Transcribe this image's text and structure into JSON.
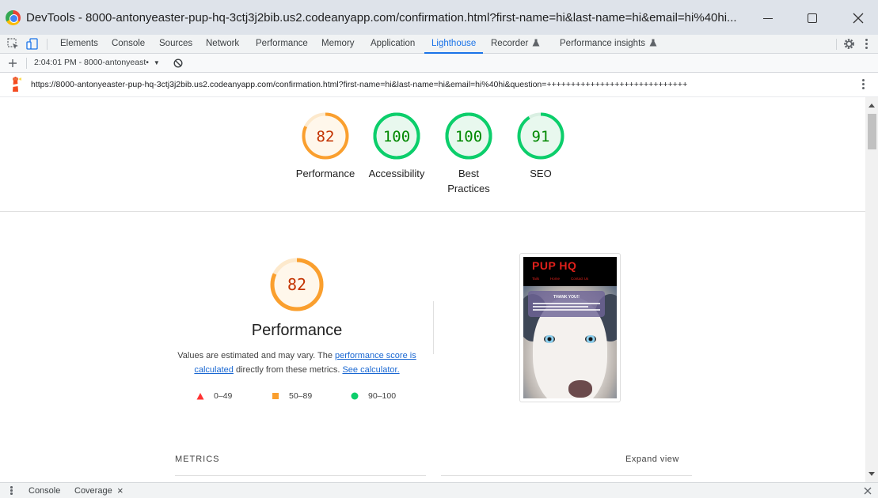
{
  "window": {
    "title": "DevTools - 8000-antonyeaster-pup-hq-3ctj3j2bib.us2.codeanyapp.com/confirmation.html?first-name=hi&last-name=hi&email=hi%40hi..."
  },
  "devtools": {
    "tabs": [
      {
        "label": "Elements"
      },
      {
        "label": "Console"
      },
      {
        "label": "Sources"
      },
      {
        "label": "Network"
      },
      {
        "label": "Performance"
      },
      {
        "label": "Memory"
      },
      {
        "label": "Application"
      },
      {
        "label": "Lighthouse",
        "active": true
      },
      {
        "label": "Recorder"
      },
      {
        "label": "Performance insights"
      }
    ]
  },
  "lighthouse_toolbar": {
    "report_select": "2:04:01 PM - 8000-antonyeast•"
  },
  "report": {
    "url": "https://8000-antonyeaster-pup-hq-3ctj3j2bib.us2.codeanyapp.com/confirmation.html?first-name=hi&last-name=hi&email=hi%40hi&question=+++++++++++++++++++++++++++++",
    "scores": [
      {
        "label": "Performance",
        "value": "82",
        "fraction": 0.82,
        "color": "#fa9f2e",
        "text_color": "#c33300",
        "fill": "#fff7eb"
      },
      {
        "label": "Accessibility",
        "value": "100",
        "fraction": 1.0,
        "color": "#0cce6b",
        "text_color": "#008800",
        "fill": "#e8f8ee"
      },
      {
        "label": "Best\nPractices",
        "value": "100",
        "fraction": 1.0,
        "color": "#0cce6b",
        "text_color": "#008800",
        "fill": "#e8f8ee"
      },
      {
        "label": "SEO",
        "value": "91",
        "fraction": 0.91,
        "color": "#0cce6b",
        "text_color": "#008800",
        "fill": "#e8f8ee"
      }
    ],
    "performance": {
      "score": "82",
      "fraction": 0.82,
      "title": "Performance",
      "desc_prefix": "Values are estimated and may vary. The ",
      "desc_link1": "performance score is calculated",
      "desc_middle": " directly from these metrics. ",
      "desc_link2": "See calculator."
    },
    "legend": [
      {
        "shape": "triangle",
        "color": "#ff3333",
        "range": "0–49"
      },
      {
        "shape": "square",
        "color": "#fa9f2e",
        "range": "50–89"
      },
      {
        "shape": "circle",
        "color": "#0cce6b",
        "range": "90–100"
      }
    ],
    "screenshot": {
      "brand": "PUP HQ",
      "nav": [
        "Tails",
        "Home",
        "Contact Us"
      ],
      "card_title": "THANK YOU!!"
    },
    "metrics_heading": "METRICS",
    "expand_view": "Expand view"
  },
  "drawer": {
    "items": [
      "Console",
      "Coverage"
    ],
    "close": "×"
  }
}
